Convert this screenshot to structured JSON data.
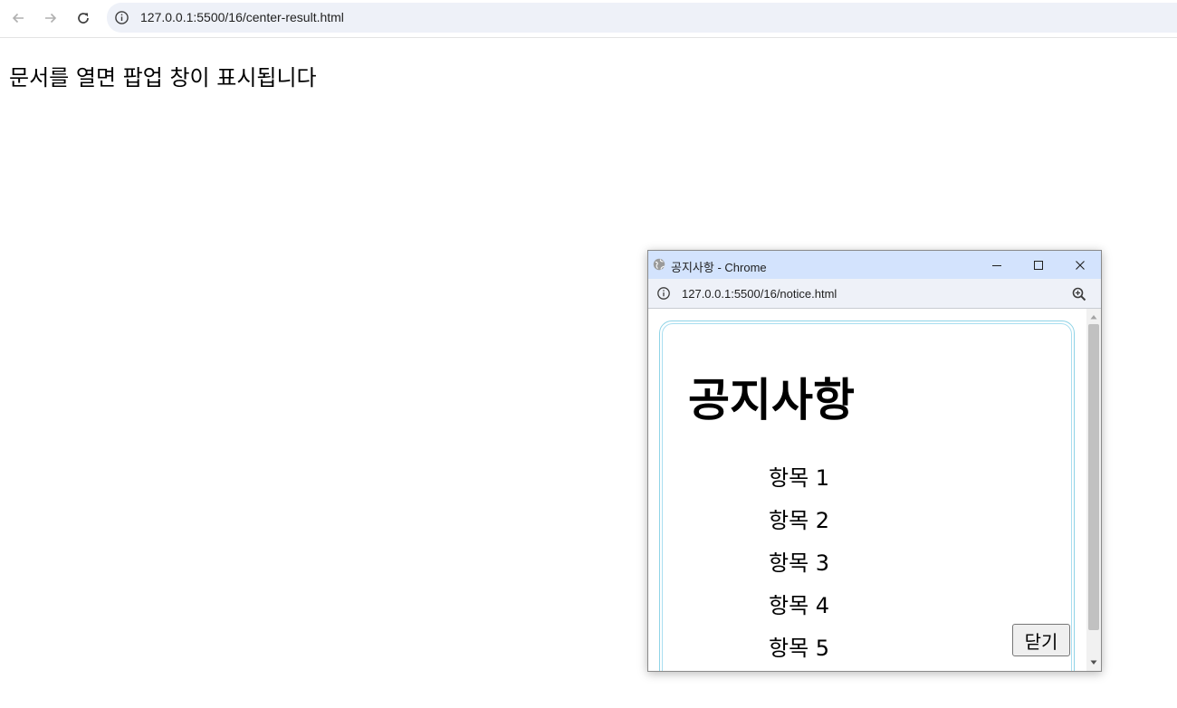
{
  "browser": {
    "url": "127.0.0.1:5500/16/center-result.html",
    "icons": {
      "back": "arrow-left-icon",
      "forward": "arrow-right-icon",
      "reload": "reload-icon",
      "site_info": "info-icon"
    }
  },
  "page": {
    "message": "문서를 열면 팝업 창이 표시됩니다"
  },
  "popup": {
    "window_title": "공지사항 - Chrome",
    "url": "127.0.0.1:5500/16/notice.html",
    "icons": {
      "favicon": "globe-icon",
      "minimize": "minimize-icon",
      "maximize": "maximize-icon",
      "close": "close-icon",
      "zoom": "zoom-in-icon"
    },
    "content": {
      "heading": "공지사항",
      "items": [
        "항목 1",
        "항목 2",
        "항목 3",
        "항목 4",
        "항목 5"
      ],
      "close_button_label": "닫기"
    },
    "colors": {
      "titlebar": "#d3e3fd",
      "addressbar": "#eef1f8",
      "box_border": "#8fd3e6"
    }
  }
}
